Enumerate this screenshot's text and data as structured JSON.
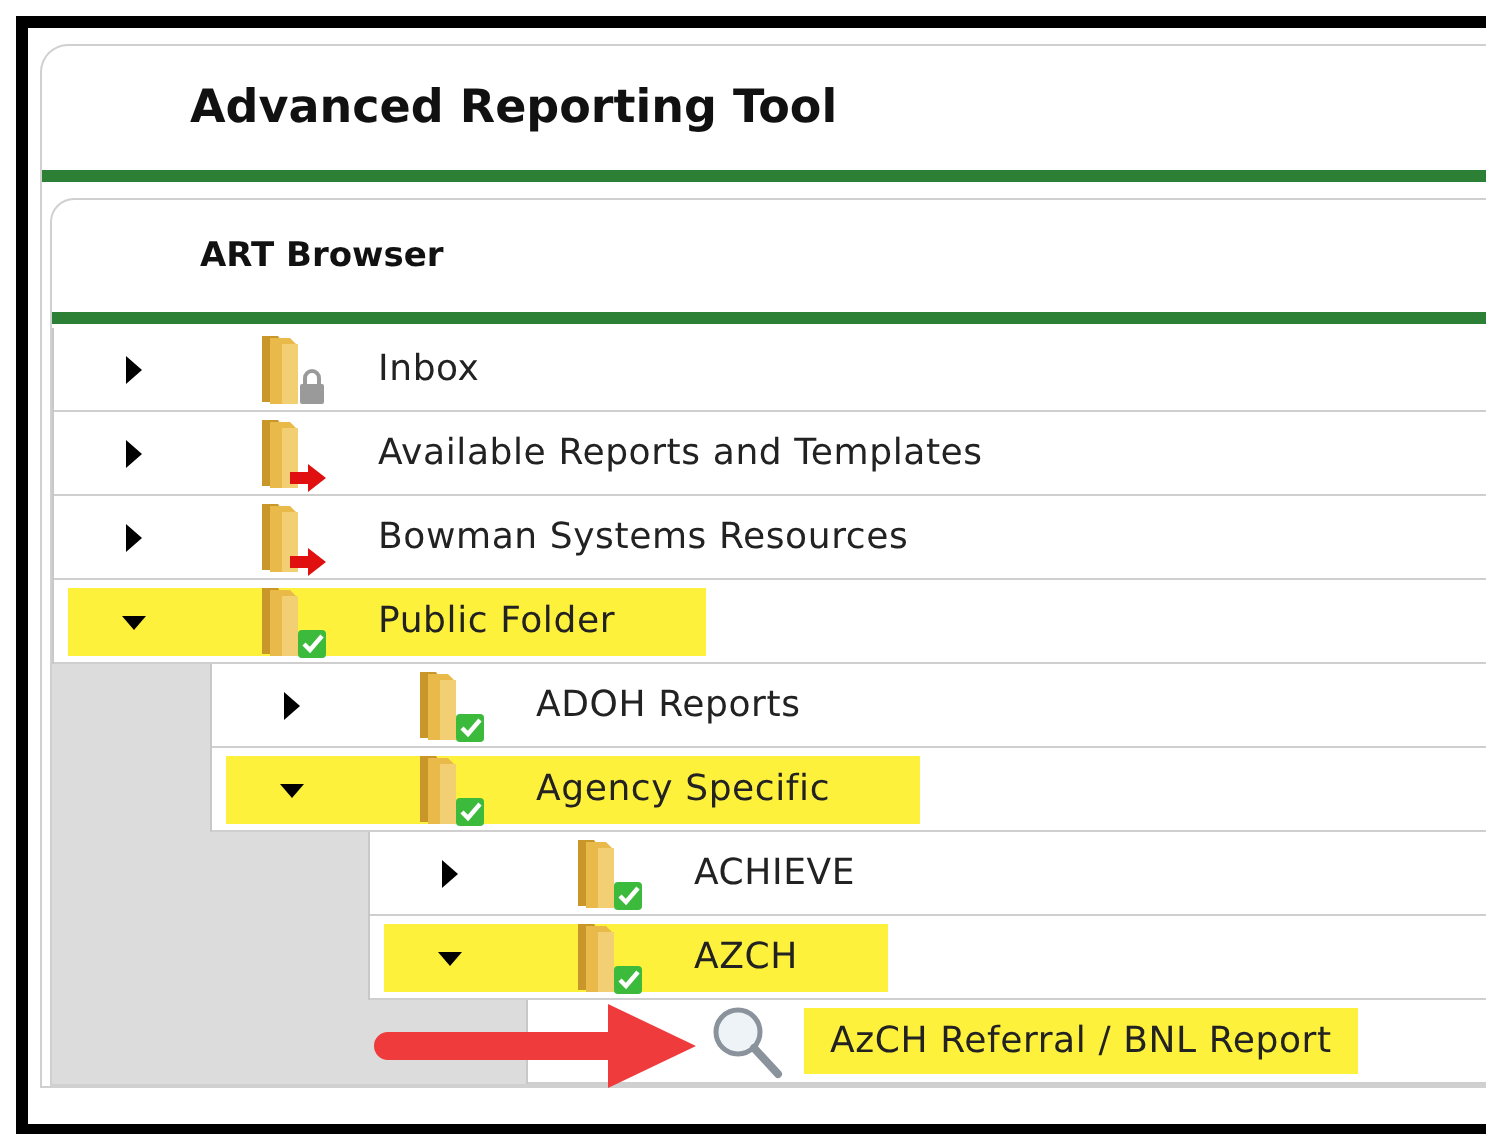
{
  "app": {
    "title": "Advanced Reporting Tool"
  },
  "browser": {
    "title": "ART Browser",
    "tree": [
      {
        "label": "Inbox",
        "kind": "locked",
        "expanded": false,
        "highlighted": false
      },
      {
        "label": "Available Reports and Templates",
        "kind": "shortcut",
        "expanded": false,
        "highlighted": false
      },
      {
        "label": "Bowman Systems Resources",
        "kind": "shortcut",
        "expanded": false,
        "highlighted": false
      },
      {
        "label": "Public Folder",
        "kind": "public",
        "expanded": true,
        "highlighted": true,
        "children": [
          {
            "label": "ADOH Reports",
            "kind": "public",
            "expanded": false,
            "highlighted": false
          },
          {
            "label": "Agency Specific",
            "kind": "public",
            "expanded": true,
            "highlighted": true,
            "children": [
              {
                "label": "ACHIEVE",
                "kind": "public",
                "expanded": false,
                "highlighted": false
              },
              {
                "label": "AZCH",
                "kind": "public",
                "expanded": true,
                "highlighted": true,
                "children": [
                  {
                    "label": "AzCH Referral / BNL Report",
                    "kind": "report",
                    "highlighted": true,
                    "pointed": true
                  }
                ]
              }
            ]
          }
        ]
      }
    ]
  }
}
